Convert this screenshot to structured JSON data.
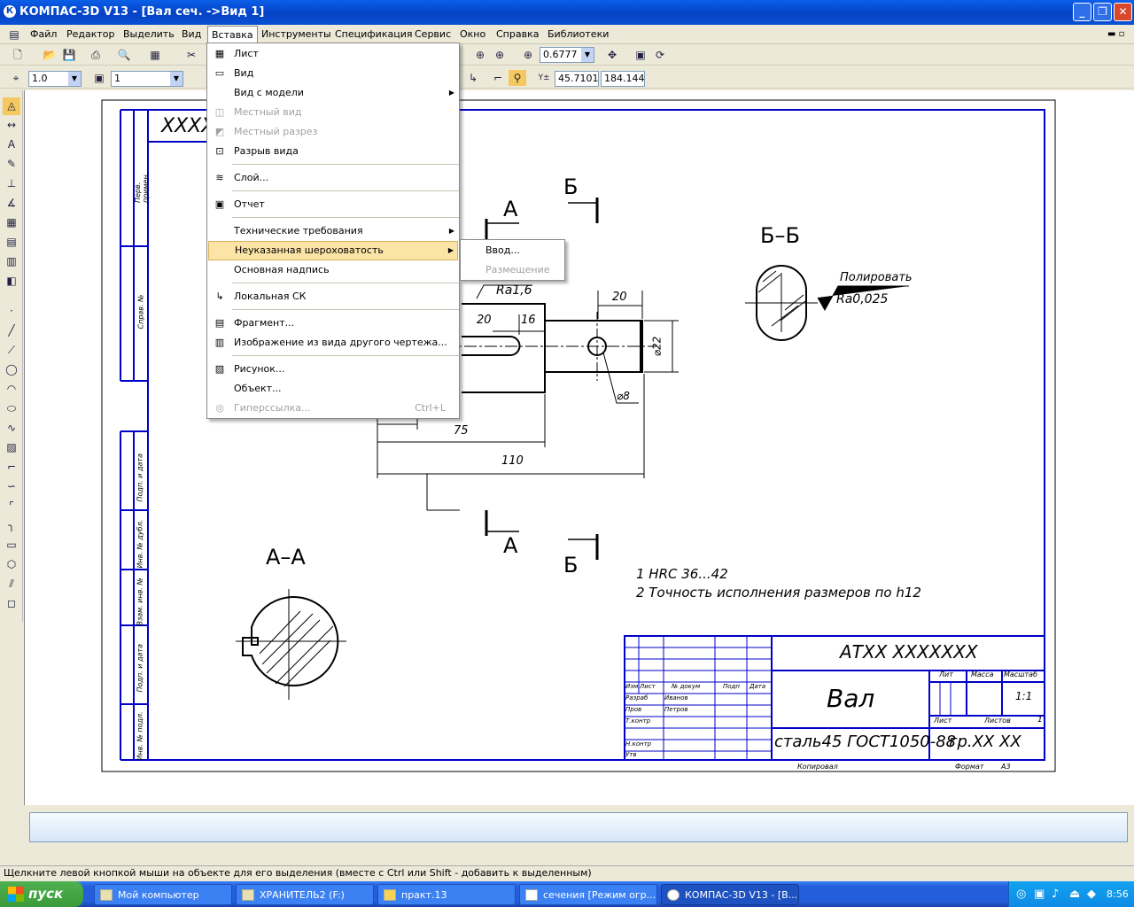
{
  "window": {
    "title": "КОМПАС-3D V13 - [Вал сеч. ->Вид 1]",
    "app_icon": "К",
    "minimize_icon": "_",
    "maximize_icon": "❐",
    "close_icon": "✕"
  },
  "menubar": {
    "items": [
      "Файл",
      "Редактор",
      "Выделить",
      "Вид",
      "Вставка",
      "Инструменты",
      "Спецификация",
      "Сервис",
      "Окно",
      "Справка",
      "Библиотеки"
    ],
    "active": "Вставка",
    "doc_controls": "▬ ▫ ✕"
  },
  "toolbar1": {
    "zoom": "0.6777"
  },
  "toolbar2": {
    "scale": "1.0",
    "layer": "1",
    "coord_x": "45.7101",
    "coord_y": "184.144"
  },
  "insert_menu": {
    "items": [
      {
        "label": "Лист",
        "icon": "sheet-icon",
        "glyph": "▦",
        "state": "enabled"
      },
      {
        "label": "Вид",
        "icon": "view-icon",
        "glyph": "▭",
        "state": "enabled"
      },
      {
        "label": "Вид с модели",
        "icon": "",
        "glyph": "",
        "state": "enabled",
        "submenu": true
      },
      {
        "label": "Местный вид",
        "icon": "local-view-icon",
        "glyph": "◫",
        "state": "disabled"
      },
      {
        "label": "Местный разрез",
        "icon": "local-section-icon",
        "glyph": "◩",
        "state": "disabled"
      },
      {
        "label": "Разрыв вида",
        "icon": "view-break-icon",
        "glyph": "⊡",
        "state": "enabled"
      },
      {
        "label": "Слой...",
        "icon": "layer-icon",
        "glyph": "≋",
        "state": "enabled"
      },
      {
        "label": "Отчет",
        "icon": "report-icon",
        "glyph": "▣",
        "state": "enabled"
      },
      {
        "label": "Технические требования",
        "icon": "",
        "glyph": "",
        "state": "enabled",
        "submenu": true
      },
      {
        "label": "Неуказанная шероховатость",
        "icon": "",
        "glyph": "",
        "state": "highlighted",
        "submenu": true
      },
      {
        "label": "Основная надпись",
        "icon": "",
        "glyph": "",
        "state": "enabled"
      },
      {
        "label": "Локальная СК",
        "icon": "local-cs-icon",
        "glyph": "↳",
        "state": "enabled"
      },
      {
        "label": "Фрагмент...",
        "icon": "fragment-icon",
        "glyph": "▤",
        "state": "enabled"
      },
      {
        "label": "Изображение из вида другого чертежа...",
        "icon": "image-from-view-icon",
        "glyph": "▥",
        "state": "enabled"
      },
      {
        "label": "Рисунок...",
        "icon": "picture-icon",
        "glyph": "▨",
        "state": "enabled"
      },
      {
        "label": "Объект...",
        "icon": "",
        "glyph": "",
        "state": "enabled"
      },
      {
        "label": "Гиперссылка...",
        "icon": "hyperlink-icon",
        "glyph": "◎",
        "state": "disabled",
        "shortcut": "Ctrl+L"
      }
    ]
  },
  "roughness_submenu": {
    "items": [
      {
        "label": "Ввод...",
        "state": "enabled"
      },
      {
        "label": "Размещение",
        "state": "disabled"
      }
    ]
  },
  "drawing": {
    "designation_partial": "XXXX",
    "section_a_label": "А",
    "section_b_label": "Б",
    "section_aa_title": "А–А",
    "section_bb_title": "Б–Б",
    "roughness_main": "Ra1,6",
    "polish_note": "Полировать",
    "polish_roughness": "Ra0,025",
    "dims": {
      "d20_top": "20",
      "d20": "20",
      "d16": "16",
      "d75": "75",
      "d110": "110",
      "dia22": "⌀22",
      "dia8": "⌀8"
    },
    "notes": [
      "1  HRC 36...42",
      "2  Точность исполнения размеров по h12"
    ],
    "stamp_vertical": [
      "Перв. примен.",
      "Справ. №",
      "Подп. и дата",
      "Инв. № дубл.",
      "Взам. инв. №",
      "Подп. и дата",
      "Инв. № подл."
    ],
    "title_block": {
      "designation": "АТХХ ХХХХХХХ",
      "name": "Вал",
      "material": "сталь45 ГОСТ1050-88",
      "group": "гр.ХХ ХХ",
      "lit": "Лит",
      "mass": "Масса",
      "scale_h": "Масштаб",
      "scale": "1:1",
      "sheet": "Лист",
      "sheets": "Листов",
      "sheets_count": "1",
      "izm": "Изм",
      "list": "Лист",
      "doc": "№ докум",
      "sign": "Подп",
      "date": "Дата",
      "razrab": "Разраб",
      "razrab_name": "Иванов",
      "prov": "Пров",
      "prov_name": "Петров",
      "tkontr": "Т.контр",
      "nkontr": "Н.контр",
      "utv": "Утв",
      "copied": "Копировал",
      "format": "Формат",
      "format_val": "А3"
    }
  },
  "status": {
    "hint": "Щелкните левой кнопкой мыши на объекте для его выделения (вместе с Ctrl или Shift - добавить к выделенным)"
  },
  "taskbar": {
    "start": "пуск",
    "tasks": [
      "Мой компьютер",
      "ХРАНИТЕЛЬ2 (F:)",
      "практ.13",
      "сечения [Режим огр...",
      "КОМПАС-3D V13 - [В..."
    ],
    "clock": "8:56"
  },
  "colors": {
    "title_bar": "#0542c4",
    "drawing_frame": "#0000c8",
    "highlight": "#fbe4a6",
    "taskbar": "#245edb",
    "start": "#3a9a3a"
  }
}
